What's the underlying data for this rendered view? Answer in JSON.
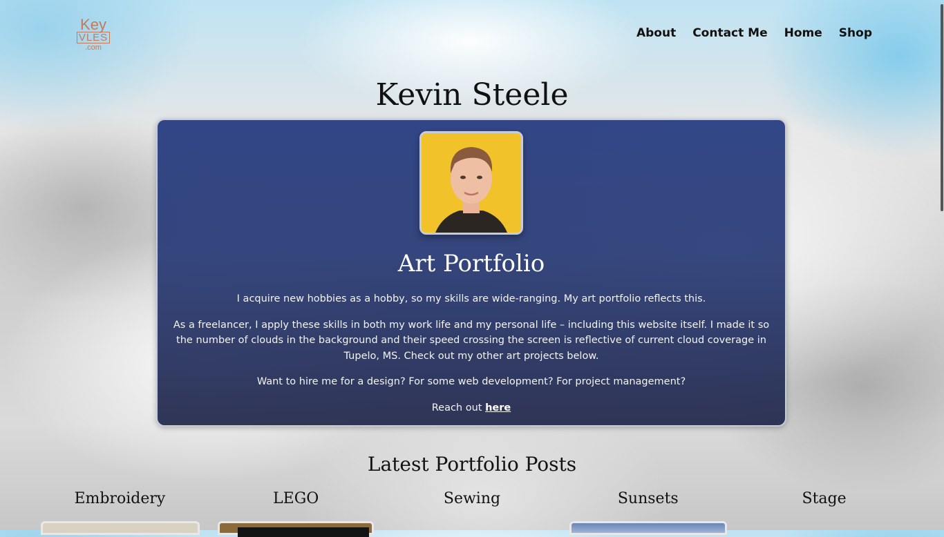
{
  "logo": {
    "line1": "Key",
    "line2": "VLES",
    "line3": ".com"
  },
  "nav": {
    "items": [
      "About",
      "Contact Me",
      "Home",
      "Shop"
    ]
  },
  "main": {
    "title": "Kevin Steele"
  },
  "card": {
    "title": "Art Portfolio",
    "p1": "I acquire new hobbies as a hobby, so my skills are wide-ranging. My art portfolio reflects this.",
    "p2": "As a freelancer, I apply these skills in both my work life and my personal life – including this website itself. I made it so the number of clouds in the background and their speed crossing the screen is reflective of current cloud coverage in Tupelo, MS. Check out my other art projects below.",
    "p3": "Want to hire me for a design? For some web development? For project management?",
    "p4_prefix": "Reach out ",
    "p4_link": "here"
  },
  "posts": {
    "title": "Latest Portfolio Posts",
    "categories": [
      "Embroidery",
      "LEGO",
      "Sewing",
      "Sunsets",
      "Stage"
    ]
  }
}
